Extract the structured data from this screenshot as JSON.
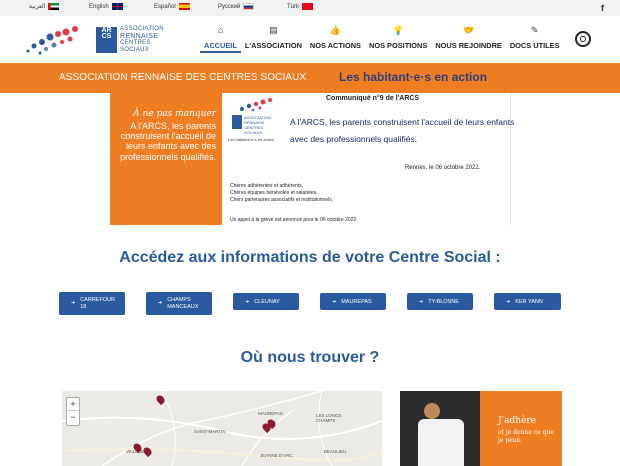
{
  "languages": [
    {
      "label": "العربية",
      "flag_colors": [
        "#009639",
        "#ffffff",
        "#000000"
      ]
    },
    {
      "label": "English",
      "flag_colors": [
        "#012169",
        "#ffffff",
        "#c8102e"
      ]
    },
    {
      "label": "Español",
      "flag_colors": [
        "#c60b1e",
        "#ffc400",
        "#c60b1e"
      ]
    },
    {
      "label": "Русский",
      "flag_colors": [
        "#ffffff",
        "#0039a6",
        "#d52b1e"
      ]
    },
    {
      "label": "Türk",
      "flag_colors": [
        "#e30a17",
        "#e30a17",
        "#e30a17"
      ]
    }
  ],
  "social": {
    "icon": "facebook-icon",
    "glyph": "f"
  },
  "logo": {
    "box_text": "ARCS",
    "line1": "ASSOCIATION",
    "line2": "RENNAISE",
    "line3": "CENTRES",
    "line4": "SOCIAUX"
  },
  "nav": [
    {
      "label": "ACCUEIL",
      "icon": "home-icon",
      "glyph": "",
      "active": true
    },
    {
      "label": "L'ASSOCIATION",
      "icon": "clipboard-icon",
      "glyph": "▤"
    },
    {
      "label": "NOS ACTIONS",
      "icon": "thumbs-up-icon",
      "glyph": "👍"
    },
    {
      "label": "NOS POSITIONS",
      "icon": "lightbulb-icon",
      "glyph": "💡"
    },
    {
      "label": "NOUS REJOINDRE",
      "icon": "handshake-icon",
      "glyph": "🤝"
    },
    {
      "label": "DOCS UTILES",
      "icon": "edit-icon",
      "glyph": "✎"
    }
  ],
  "search": {
    "glyph": "🔍"
  },
  "band": {
    "title": "ASSOCIATION RENNAISE DES CENTRES SOCIAUX",
    "slogan": "Les habitant·e·s en action"
  },
  "news": {
    "kicker": "À ne pas manquer",
    "text": "A l'ARCS, les parents construisent l'accueil de leurs enfants avec des professionnels qualifiés."
  },
  "communique": {
    "heading": "Communiqué n°9 de l'ARCS",
    "logo_line1": "ASSOCIATION",
    "logo_line2": "RENNAISE",
    "logo_line3": "CENTRES",
    "logo_line4": "SOCIAUX",
    "subtitle": "Les habitant·e·s en action",
    "lead": "A l'ARCS, les parents construisent l'accueil de leurs enfants avec des professionnels qualifiés.",
    "date": "Rennes, le 06 octobre 2022.",
    "greet1": "Chères adhérentes et adhérents,",
    "greet2": "Chères équipes bénévoles et salariées,",
    "greet3": "Chers partenaires associatifs et institutionnels,",
    "note": "Un appel à la grève est annoncé pour le 06 octobre 2022."
  },
  "centres": {
    "title": "Accédez aux informations de votre Centre Social :",
    "buttons": [
      {
        "line1": "CARREFOUR",
        "line2": "18"
      },
      {
        "line1": "CHAMPS",
        "line2": "MANCEAUX"
      },
      {
        "line1": "CLEUNAY",
        "line2": ""
      },
      {
        "line1": "MAUREPAS",
        "line2": ""
      },
      {
        "line1": "TY-BLOSNE",
        "line2": ""
      },
      {
        "line1": "KER YANN",
        "line2": ""
      }
    ]
  },
  "map": {
    "title": "Où nous trouver ?",
    "zoom_in": "+",
    "zoom_out": "−",
    "labels": {
      "maurepas": "MAUREPAS",
      "longs_champs": "LES LONGS CHAMPS",
      "saint_martin": "SAINT-MARTIN",
      "jeanne_darc": "JEANNE D'ARC",
      "beaulieu": "BEAULIEU",
      "villejean": "VILLEJEAN"
    }
  },
  "adhere": {
    "title": "J'adhère",
    "sub": "et je donne ce que je peux."
  },
  "colors": {
    "brand_blue": "#2c5aa0",
    "orange": "#ef7d22",
    "navy": "#2c3e80",
    "pin": "#8b1a2e"
  }
}
